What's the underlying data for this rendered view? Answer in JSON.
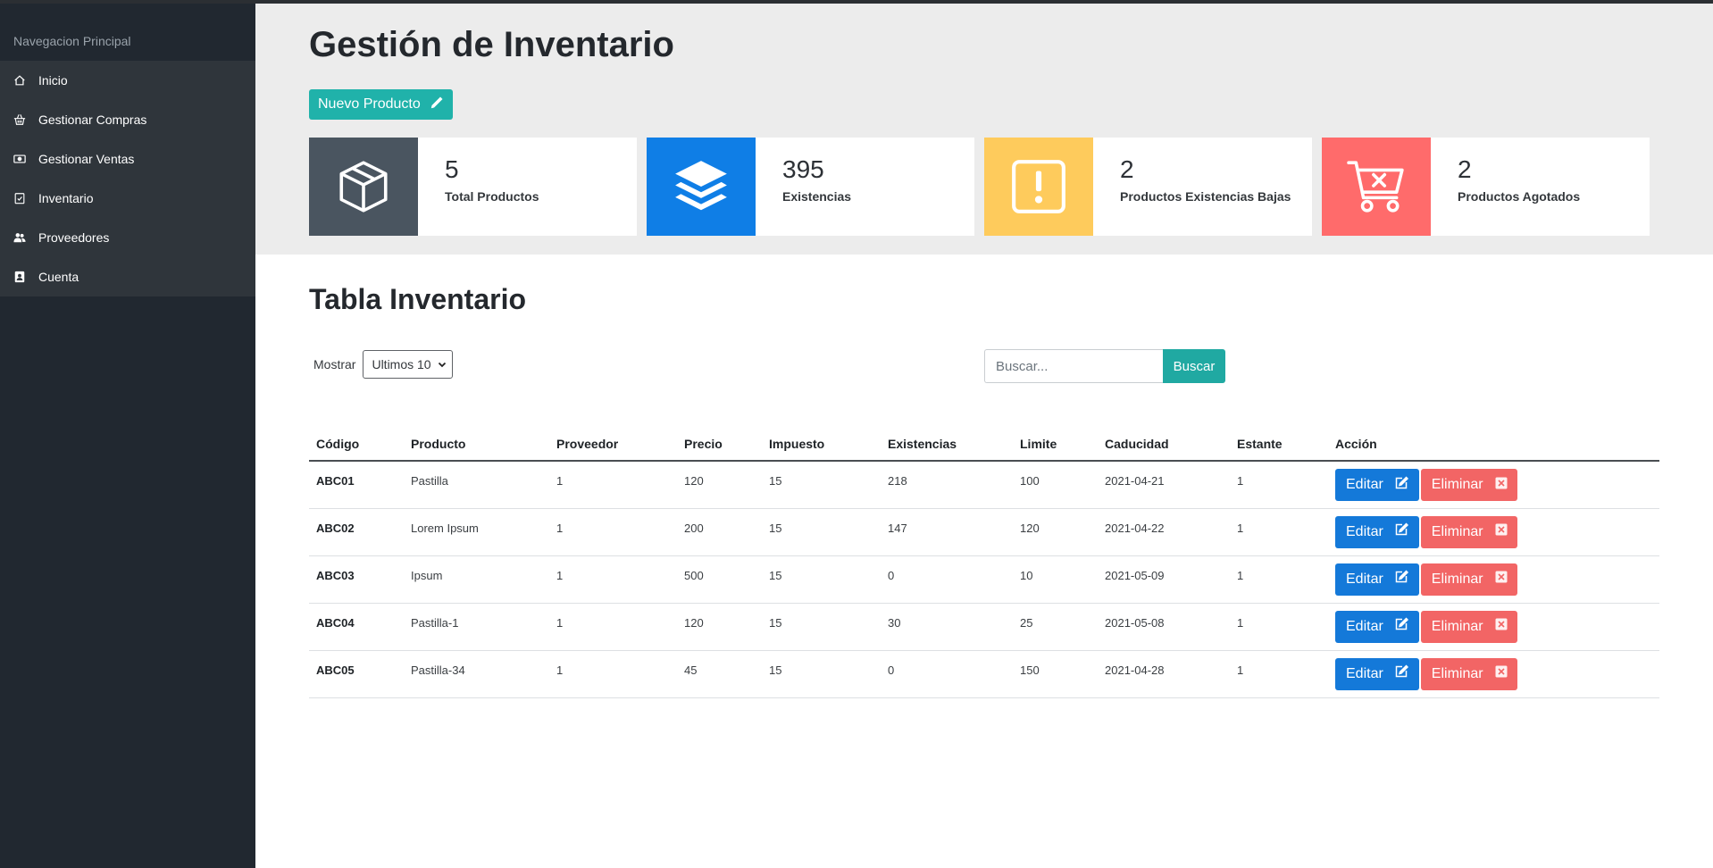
{
  "sidebar": {
    "heading": "Navegacion Principal",
    "items": [
      {
        "label": "Inicio",
        "icon": "home-icon"
      },
      {
        "label": "Gestionar Compras",
        "icon": "basket-icon"
      },
      {
        "label": "Gestionar Ventas",
        "icon": "cash-icon"
      },
      {
        "label": "Inventario",
        "icon": "clipboard-check-icon"
      },
      {
        "label": "Proveedores",
        "icon": "people-icon"
      },
      {
        "label": "Cuenta",
        "icon": "person-badge-icon"
      }
    ]
  },
  "header": {
    "title": "Gestión de Inventario",
    "new_button": "Nuevo Producto"
  },
  "cards": [
    {
      "value": "5",
      "label": "Total Productos",
      "icon": "box-icon",
      "color": "#4a5560"
    },
    {
      "value": "395",
      "label": "Existencias",
      "icon": "layers-icon",
      "color": "#0f7ee6"
    },
    {
      "value": "2",
      "label": "Productos Existencias Bajas",
      "icon": "warning-icon",
      "color": "#fecb5c"
    },
    {
      "value": "2",
      "label": "Productos Agotados",
      "icon": "cart-x-icon",
      "color": "#ff6b6b"
    }
  ],
  "table_section": {
    "title": "Tabla Inventario",
    "show_label": "Mostrar",
    "show_selected": "Ultimos 10",
    "search_placeholder": "Buscar...",
    "search_button": "Buscar"
  },
  "table": {
    "headers": [
      "Código",
      "Producto",
      "Proveedor",
      "Precio",
      "Impuesto",
      "Existencias",
      "Limite",
      "Caducidad",
      "Estante",
      "Acción"
    ],
    "edit_label": "Editar",
    "delete_label": "Eliminar",
    "rows": [
      {
        "codigo": "ABC01",
        "producto": "Pastilla",
        "proveedor": "1",
        "precio": "120",
        "impuesto": "15",
        "existencias": "218",
        "limite": "100",
        "caducidad": "2021-04-21",
        "estante": "1"
      },
      {
        "codigo": "ABC02",
        "producto": "Lorem Ipsum",
        "proveedor": "1",
        "precio": "200",
        "impuesto": "15",
        "existencias": "147",
        "limite": "120",
        "caducidad": "2021-04-22",
        "estante": "1"
      },
      {
        "codigo": "ABC03",
        "producto": "Ipsum",
        "proveedor": "1",
        "precio": "500",
        "impuesto": "15",
        "existencias": "0",
        "limite": "10",
        "caducidad": "2021-05-09",
        "estante": "1"
      },
      {
        "codigo": "ABC04",
        "producto": "Pastilla-1",
        "proveedor": "1",
        "precio": "120",
        "impuesto": "15",
        "existencias": "30",
        "limite": "25",
        "caducidad": "2021-05-08",
        "estante": "1"
      },
      {
        "codigo": "ABC05",
        "producto": "Pastilla-34",
        "proveedor": "1",
        "precio": "45",
        "impuesto": "15",
        "existencias": "0",
        "limite": "150",
        "caducidad": "2021-04-28",
        "estante": "1"
      }
    ]
  }
}
